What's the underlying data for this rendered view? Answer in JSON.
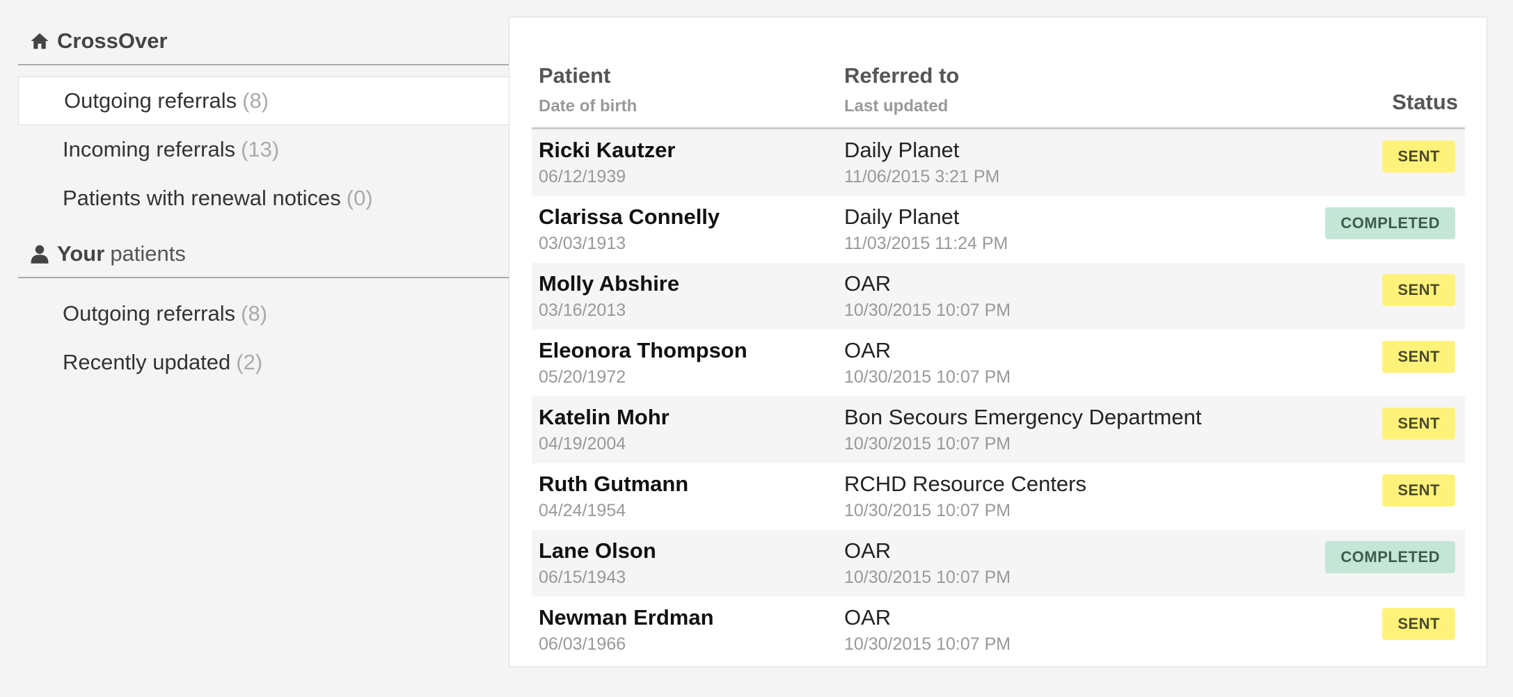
{
  "sidebar": {
    "crossover": {
      "title": "CrossOver",
      "icon": "home-icon",
      "items": [
        {
          "label": "Outgoing referrals",
          "count": "(8)",
          "active": true
        },
        {
          "label": "Incoming referrals",
          "count": "(13)",
          "active": false
        },
        {
          "label": "Patients with renewal notices",
          "count": "(0)",
          "active": false
        }
      ]
    },
    "your_patients": {
      "title_bold": "Your",
      "title_light": "patients",
      "icon": "user-icon",
      "items": [
        {
          "label": "Outgoing referrals",
          "count": "(8)"
        },
        {
          "label": "Recently updated",
          "count": "(2)"
        }
      ]
    }
  },
  "table": {
    "headers": {
      "patient": "Patient",
      "dob": "Date of birth",
      "referred_to": "Referred to",
      "last_updated": "Last updated",
      "status": "Status"
    },
    "rows": [
      {
        "name": "Ricki Kautzer",
        "dob": "06/12/1939",
        "referred_to": "Daily Planet",
        "updated": "11/06/2015 3:21 PM",
        "status": "SENT"
      },
      {
        "name": "Clarissa Connelly",
        "dob": "03/03/1913",
        "referred_to": "Daily Planet",
        "updated": "11/03/2015 11:24 PM",
        "status": "COMPLETED"
      },
      {
        "name": "Molly Abshire",
        "dob": "03/16/2013",
        "referred_to": "OAR",
        "updated": "10/30/2015 10:07 PM",
        "status": "SENT"
      },
      {
        "name": "Eleonora Thompson",
        "dob": "05/20/1972",
        "referred_to": "OAR",
        "updated": "10/30/2015 10:07 PM",
        "status": "SENT"
      },
      {
        "name": "Katelin Mohr",
        "dob": "04/19/2004",
        "referred_to": "Bon Secours Emergency Department",
        "updated": "10/30/2015 10:07 PM",
        "status": "SENT"
      },
      {
        "name": "Ruth Gutmann",
        "dob": "04/24/1954",
        "referred_to": "RCHD Resource Centers",
        "updated": "10/30/2015 10:07 PM",
        "status": "SENT"
      },
      {
        "name": "Lane Olson",
        "dob": "06/15/1943",
        "referred_to": "OAR",
        "updated": "10/30/2015 10:07 PM",
        "status": "COMPLETED"
      },
      {
        "name": "Newman Erdman",
        "dob": "06/03/1966",
        "referred_to": "OAR",
        "updated": "10/30/2015 10:07 PM",
        "status": "SENT"
      }
    ]
  },
  "colors": {
    "sent_badge": "#fff27a",
    "completed_badge": "#c3e6d7",
    "background": "#f4f4f4"
  }
}
